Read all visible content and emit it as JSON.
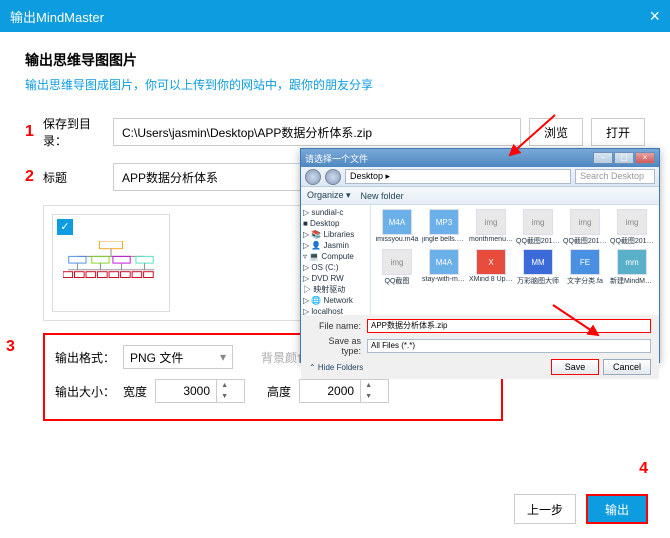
{
  "titlebar": {
    "title": "输出MindMaster"
  },
  "header": {
    "title": "输出思维导图图片",
    "subtitle": "输出思维导图成图片，你可以上传到你的网站中，跟你的朋友分享"
  },
  "annotations": {
    "n1": "1",
    "n2": "2",
    "n3": "3",
    "n4": "4"
  },
  "form": {
    "save_label": "保存到目录：",
    "save_value": "C:\\Users\\jasmin\\Desktop\\APP数据分析体系.zip",
    "browse": "浏览",
    "open": "打开",
    "title_label": "标题",
    "title_value": "APP数据分析体系"
  },
  "output": {
    "format_label": "输出格式：",
    "format_value": "PNG 文件",
    "bg_label": "背景颜色：",
    "size_label": "输出大小：",
    "width_label": "宽度",
    "width_value": "3000",
    "height_label": "高度",
    "height_value": "2000"
  },
  "footer": {
    "prev": "上一步",
    "export": "输出"
  },
  "dialog": {
    "title": "请选择一个文件",
    "path": "Desktop",
    "search_ph": "Search Desktop",
    "organize": "Organize ▾",
    "newfolder": "New folder",
    "tree": [
      "▷ sundial-c",
      "■ Desktop",
      "▷ 📚 Libraries",
      "▷ 👤 Jasmin",
      "▿ 💻 Compute",
      "  ▷ OS (C:)",
      "  ▷ DVD RW",
      "  ▷ 映射驱动",
      "▷ 🌐 Network",
      "  ▷ localhost"
    ],
    "files": [
      {
        "icon": "M4A",
        "name": "imissyou.m4a",
        "style": "audio"
      },
      {
        "icon": "MP3",
        "name": "jingle bells.mp3",
        "style": "audio"
      },
      {
        "icon": "img",
        "name": "monthmenu.png",
        "style": "img"
      },
      {
        "icon": "img",
        "name": "QQ截图20171023171.png",
        "style": "img"
      },
      {
        "icon": "img",
        "name": "QQ截图20171023171701.png",
        "style": "img"
      },
      {
        "icon": "img",
        "name": "QQ截图20171023171.png",
        "style": "img"
      },
      {
        "icon": "img",
        "name": "QQ截图",
        "style": "img"
      },
      {
        "icon": "M4A",
        "name": "stay-with-me.m4a",
        "style": "audio"
      },
      {
        "icon": "X",
        "name": "XMind 8 Update 5",
        "style": "xmind"
      },
      {
        "icon": "MM",
        "name": "万彩脑图大师",
        "style": "mm"
      },
      {
        "icon": "FE",
        "name": "文字分类.fa",
        "style": "fe"
      },
      {
        "icon": "mm",
        "name": "新建MindMaster.mm",
        "style": "mmf"
      }
    ],
    "filename_label": "File name:",
    "filename_value": "APP数据分析体系.zip",
    "savetype_label": "Save as type:",
    "savetype_value": "All Files (*.*)",
    "hide": "⌃ Hide Folders",
    "save": "Save",
    "cancel": "Cancel"
  }
}
